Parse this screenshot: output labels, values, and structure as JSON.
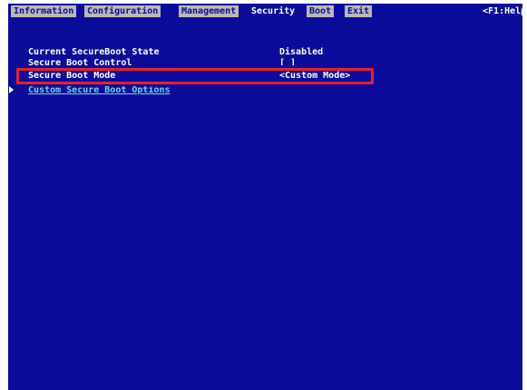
{
  "tabs": [
    {
      "label": "Information",
      "active": false
    },
    {
      "label": "Configuration",
      "active": false
    },
    {
      "label": "Management",
      "active": false
    },
    {
      "label": "Security",
      "active": true
    },
    {
      "label": "Boot",
      "active": false
    },
    {
      "label": "Exit",
      "active": false
    }
  ],
  "help_hint": "<F1:Help",
  "settings": [
    {
      "label": "Current SecureBoot State",
      "value": "Disabled"
    },
    {
      "label": "Secure Boot Control",
      "value": "[ ]"
    },
    {
      "label": "Secure Boot Mode",
      "value": "<Custom Mode>"
    }
  ],
  "submenu": {
    "label": "Custom Secure Boot Options"
  },
  "colors": {
    "background": "#0c0c9a",
    "tab_inactive": "#b8b8b8",
    "highlight_border": "#e8202a",
    "submenu_text": "#5fe0d8"
  }
}
